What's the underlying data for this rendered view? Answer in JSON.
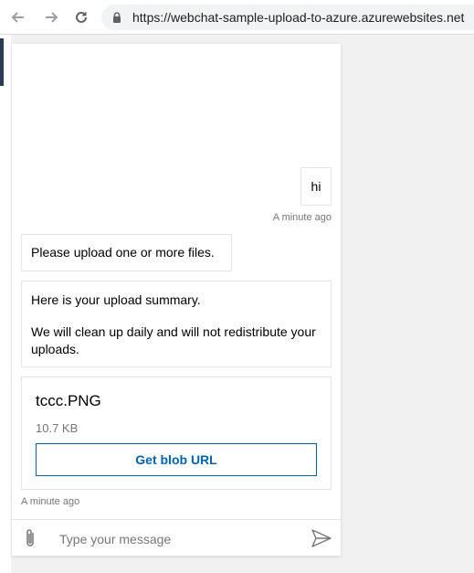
{
  "browser": {
    "url": "https://webchat-sample-upload-to-azure.azurewebsites.net"
  },
  "chat": {
    "messages": {
      "user_text": "hi",
      "user_timestamp": "A minute ago",
      "bot_text_1": "Please upload one or more files.",
      "summary_line_1": "Here is your upload summary.",
      "summary_line_2": "We will clean up daily and will not redistribute your uploads.",
      "file_name": "tccc.PNG",
      "file_size": "10.7 KB",
      "button_label": "Get blob URL",
      "bot_timestamp": "A minute ago"
    },
    "sendbox": {
      "placeholder": "Type your message"
    }
  },
  "colors": {
    "accent": "#0063b1",
    "timestamp": "#767676"
  }
}
